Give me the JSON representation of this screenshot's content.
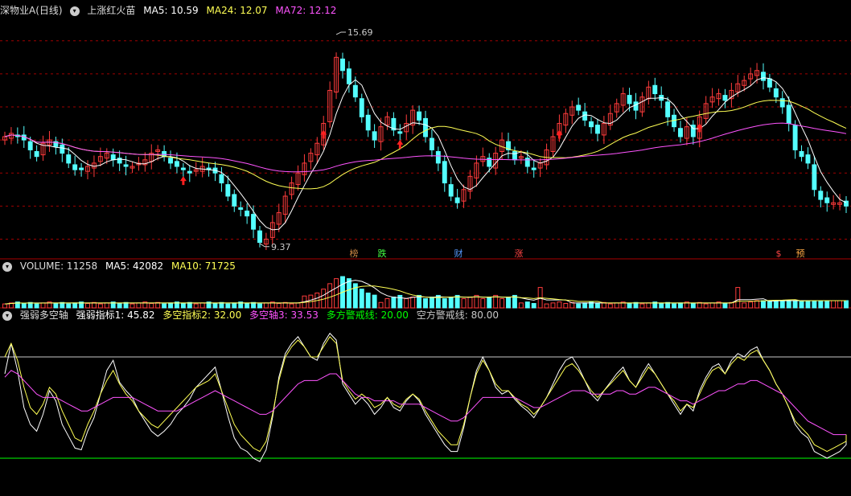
{
  "header_main": {
    "stock": "深物业A(日线)",
    "indicator": "上涨红火苗",
    "ma5": "MA5: 10.59",
    "ma24": "MA24: 12.07",
    "ma72": "MA72: 12.12"
  },
  "header_volume": {
    "name": "VOLUME: 11258",
    "ma5": "MA5: 42082",
    "ma10": "MA10: 71725"
  },
  "header_osc": {
    "name": "强弱多空轴",
    "i1": "强弱指标1: 45.82",
    "i2": "多空指标2: 32.00",
    "i3": "多空轴3: 33.53",
    "l1": "多方警戒线: 20.00",
    "l2": "空方警戒线: 80.00"
  },
  "colors": {
    "up": "#ff3c3c",
    "down": "#54ffff",
    "ma5": "#ffffff",
    "ma24": "#ffff54",
    "ma72": "#ff54ff",
    "grid": "#a00000",
    "bull_line": "#00ff00",
    "bear_line": "#c8c8c8"
  },
  "chart_data": [
    {
      "type": "candlestick",
      "name": "price",
      "ylim": [
        9.0,
        16.2
      ],
      "high_label": "15.69",
      "low_label": "9.37",
      "close": [
        12.6,
        12.7,
        12.6,
        12.5,
        12.2,
        12.0,
        12.4,
        12.5,
        12.3,
        12.1,
        11.8,
        11.6,
        11.6,
        11.7,
        11.8,
        12.0,
        12.1,
        11.9,
        11.8,
        11.7,
        11.7,
        11.8,
        11.9,
        12.1,
        12.2,
        12.0,
        11.8,
        11.7,
        11.6,
        11.5,
        11.6,
        11.7,
        11.6,
        11.5,
        11.2,
        10.8,
        10.5,
        10.4,
        10.2,
        9.8,
        9.4,
        9.5,
        10.0,
        10.3,
        10.8,
        11.2,
        11.5,
        11.8,
        12.1,
        12.4,
        13.0,
        14.0,
        15.0,
        14.6,
        14.2,
        13.8,
        13.2,
        12.8,
        12.5,
        12.9,
        13.2,
        12.8,
        12.7,
        13.0,
        13.4,
        13.1,
        12.6,
        12.2,
        11.8,
        11.2,
        10.8,
        10.6,
        11.0,
        11.4,
        11.8,
        12.0,
        11.7,
        12.1,
        12.5,
        12.2,
        11.9,
        12.0,
        11.7,
        11.6,
        11.8,
        12.2,
        12.6,
        13.0,
        13.3,
        13.5,
        13.4,
        13.1,
        12.9,
        12.7,
        13.0,
        13.3,
        13.6,
        13.9,
        13.6,
        13.4,
        13.8,
        14.1,
        13.9,
        13.7,
        13.2,
        12.9,
        12.6,
        12.9,
        12.6,
        13.2,
        13.6,
        13.8,
        13.9,
        13.7,
        14.0,
        14.2,
        14.3,
        14.5,
        14.6,
        14.3,
        14.1,
        13.8,
        13.5,
        13.0,
        12.2,
        12.0,
        11.8,
        11.0,
        10.7,
        10.6,
        10.6,
        10.6,
        10.5
      ]
    },
    {
      "type": "bar",
      "name": "VOLUME",
      "note": "relative height"
    },
    {
      "type": "line",
      "name": "强弱多空轴",
      "ylim": [
        0,
        100
      ],
      "bull_line": 20,
      "bear_line": 80,
      "series": [
        {
          "name": "强弱指标1",
          "values": [
            70,
            88,
            72,
            50,
            40,
            36,
            46,
            60,
            54,
            40,
            33,
            26,
            25,
            36,
            44,
            58,
            72,
            78,
            65,
            60,
            56,
            48,
            42,
            36,
            33,
            36,
            40,
            46,
            50,
            55,
            62,
            66,
            70,
            74,
            60,
            45,
            32,
            26,
            24,
            20,
            18,
            25,
            44,
            68,
            82,
            88,
            92,
            86,
            80,
            78,
            88,
            94,
            90,
            64,
            58,
            52,
            56,
            52,
            46,
            50,
            56,
            50,
            48,
            54,
            58,
            54,
            46,
            40,
            34,
            28,
            24,
            24,
            38,
            56,
            72,
            80,
            72,
            62,
            58,
            60,
            55,
            51,
            48,
            44,
            50,
            56,
            64,
            72,
            78,
            80,
            74,
            66,
            58,
            54,
            60,
            65,
            70,
            74,
            66,
            62,
            70,
            76,
            70,
            64,
            58,
            52,
            46,
            52,
            48,
            60,
            68,
            74,
            76,
            70,
            78,
            82,
            80,
            84,
            86,
            78,
            72,
            64,
            58,
            50,
            40,
            35,
            32,
            24,
            22,
            20,
            22,
            24,
            28,
            34
          ]
        },
        {
          "name": "多空指标2",
          "values": [
            80,
            88,
            78,
            62,
            50,
            46,
            52,
            62,
            58,
            48,
            40,
            32,
            30,
            40,
            48,
            58,
            66,
            72,
            64,
            58,
            54,
            48,
            44,
            40,
            38,
            42,
            46,
            50,
            54,
            58,
            62,
            64,
            66,
            70,
            60,
            50,
            40,
            34,
            30,
            26,
            24,
            30,
            46,
            66,
            80,
            86,
            90,
            86,
            80,
            80,
            86,
            92,
            88,
            66,
            60,
            55,
            58,
            55,
            50,
            52,
            56,
            52,
            50,
            55,
            58,
            55,
            48,
            42,
            36,
            32,
            28,
            28,
            40,
            56,
            70,
            78,
            72,
            64,
            60,
            60,
            56,
            52,
            50,
            46,
            50,
            56,
            62,
            68,
            74,
            76,
            72,
            66,
            60,
            56,
            60,
            64,
            68,
            72,
            66,
            62,
            68,
            74,
            70,
            64,
            58,
            54,
            48,
            52,
            50,
            58,
            66,
            72,
            74,
            70,
            76,
            80,
            78,
            82,
            84,
            78,
            72,
            64,
            58,
            50,
            42,
            38,
            34,
            28,
            26,
            24,
            26,
            28,
            30,
            34
          ]
        },
        {
          "name": "多空轴3",
          "values": [
            68,
            72,
            70,
            66,
            62,
            58,
            56,
            56,
            56,
            54,
            52,
            50,
            48,
            48,
            50,
            52,
            54,
            56,
            56,
            56,
            56,
            54,
            52,
            50,
            48,
            48,
            48,
            48,
            50,
            52,
            54,
            56,
            58,
            60,
            58,
            56,
            54,
            52,
            50,
            48,
            46,
            46,
            48,
            52,
            56,
            60,
            64,
            66,
            66,
            66,
            68,
            70,
            70,
            66,
            62,
            58,
            56,
            56,
            54,
            54,
            54,
            54,
            52,
            52,
            52,
            52,
            50,
            48,
            46,
            44,
            42,
            42,
            44,
            48,
            52,
            56,
            56,
            56,
            56,
            56,
            56,
            54,
            52,
            50,
            50,
            52,
            54,
            56,
            58,
            60,
            60,
            60,
            58,
            58,
            58,
            58,
            60,
            60,
            58,
            58,
            60,
            62,
            62,
            60,
            58,
            56,
            54,
            54,
            52,
            54,
            56,
            58,
            60,
            60,
            62,
            64,
            64,
            66,
            66,
            64,
            62,
            60,
            58,
            54,
            50,
            46,
            42,
            40,
            38,
            36,
            34,
            34,
            34,
            34
          ]
        }
      ]
    }
  ],
  "price_markers": [
    "榜",
    "跌",
    "财",
    "涨",
    "$",
    "预"
  ]
}
